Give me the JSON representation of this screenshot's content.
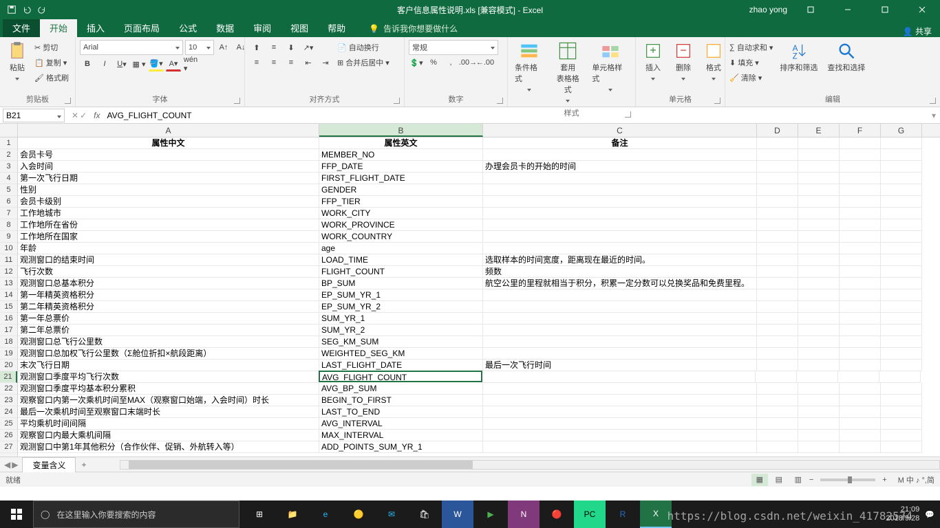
{
  "title": "客户信息属性说明.xls  [兼容模式]  -  Excel",
  "user": "zhao yong",
  "tabs": {
    "file": "文件",
    "home": "开始",
    "insert": "插入",
    "layout": "页面布局",
    "formula": "公式",
    "data": "数据",
    "review": "审阅",
    "view": "视图",
    "help": "帮助",
    "tellme": "告诉我你想要做什么",
    "share": "共享"
  },
  "ribbon": {
    "clipboard": {
      "paste": "粘贴",
      "cut": "剪切",
      "copy": "复制",
      "format_painter": "格式刷",
      "label": "剪贴板"
    },
    "font": {
      "name": "Arial",
      "size": "10",
      "label": "字体"
    },
    "align": {
      "wrap": "自动换行",
      "merge": "合并后居中",
      "label": "对齐方式"
    },
    "number": {
      "format": "常规",
      "label": "数字"
    },
    "styles": {
      "cond": "条件格式",
      "table": "套用\n表格格式",
      "cell": "单元格样式",
      "label": "样式"
    },
    "cells": {
      "insert": "插入",
      "delete": "删除",
      "format": "格式",
      "label": "单元格"
    },
    "editing": {
      "autosum": "自动求和",
      "fill": "填充",
      "clear": "清除",
      "sort": "排序和筛选",
      "find": "查找和选择",
      "label": "编辑"
    }
  },
  "namebox": "B21",
  "formula_value": "AVG_FLIGHT_COUNT",
  "columns": [
    "A",
    "B",
    "C",
    "D",
    "E",
    "F",
    "G"
  ],
  "col_headers": {
    "A": "属性中文",
    "B": "属性英文",
    "C": "备注"
  },
  "rows": [
    [
      "会员卡号",
      "MEMBER_NO",
      ""
    ],
    [
      "入会时间",
      "FFP_DATE",
      "办理会员卡的开始的时间"
    ],
    [
      "第一次飞行日期",
      "FIRST_FLIGHT_DATE",
      ""
    ],
    [
      "性别",
      "GENDER",
      ""
    ],
    [
      "会员卡级别",
      "FFP_TIER",
      ""
    ],
    [
      "工作地城市",
      "WORK_CITY",
      ""
    ],
    [
      "工作地所在省份",
      "WORK_PROVINCE",
      ""
    ],
    [
      "工作地所在国家",
      "WORK_COUNTRY",
      ""
    ],
    [
      "年龄",
      "age",
      ""
    ],
    [
      "观测窗口的结束时间",
      "LOAD_TIME",
      "选取样本的时间宽度，距离现在最近的时间。"
    ],
    [
      "飞行次数",
      "FLIGHT_COUNT",
      "频数"
    ],
    [
      "观测窗口总基本积分",
      "BP_SUM",
      "航空公里的里程就相当于积分，积累一定分数可以兑换奖品和免费里程。"
    ],
    [
      "第一年精英资格积分",
      "EP_SUM_YR_1",
      ""
    ],
    [
      "第二年精英资格积分",
      "EP_SUM_YR_2",
      ""
    ],
    [
      "第一年总票价",
      "SUM_YR_1",
      ""
    ],
    [
      "第二年总票价",
      "SUM_YR_2",
      ""
    ],
    [
      "观测窗口总飞行公里数",
      "SEG_KM_SUM",
      ""
    ],
    [
      "观测窗口总加权飞行公里数（Σ舱位折扣×航段距离）",
      "WEIGHTED_SEG_KM",
      ""
    ],
    [
      "末次飞行日期",
      "LAST_FLIGHT_DATE",
      "最后一次飞行时间"
    ],
    [
      "观测窗口季度平均飞行次数",
      "AVG_FLIGHT_COUNT",
      ""
    ],
    [
      "观测窗口季度平均基本积分累积",
      "AVG_BP_SUM",
      ""
    ],
    [
      "观察窗口内第一次乘机时间至MAX（观察窗口始端，入会时间）时长",
      "BEGIN_TO_FIRST",
      ""
    ],
    [
      "最后一次乘机时间至观察窗口末端时长",
      "LAST_TO_END",
      ""
    ],
    [
      "平均乘机时间间隔",
      "AVG_INTERVAL",
      ""
    ],
    [
      "观察窗口内最大乘机间隔",
      "MAX_INTERVAL",
      ""
    ],
    [
      "观测窗口中第1年其他积分（合作伙伴、促销、外航转入等）",
      "ADD_POINTS_SUM_YR_1",
      ""
    ]
  ],
  "active_cell": {
    "row": 21,
    "col": "B"
  },
  "sheet": {
    "name": "变量含义",
    "add": "+"
  },
  "status": {
    "ready": "就绪",
    "zoom": "100%",
    "ime": "M 中 ♪ °,简"
  },
  "taskbar": {
    "search_placeholder": "在这里输入你要搜索的内容",
    "time": "21:09",
    "date": "2018/9/28"
  },
  "watermark": "https://blog.csdn.net/weixin_41782574"
}
